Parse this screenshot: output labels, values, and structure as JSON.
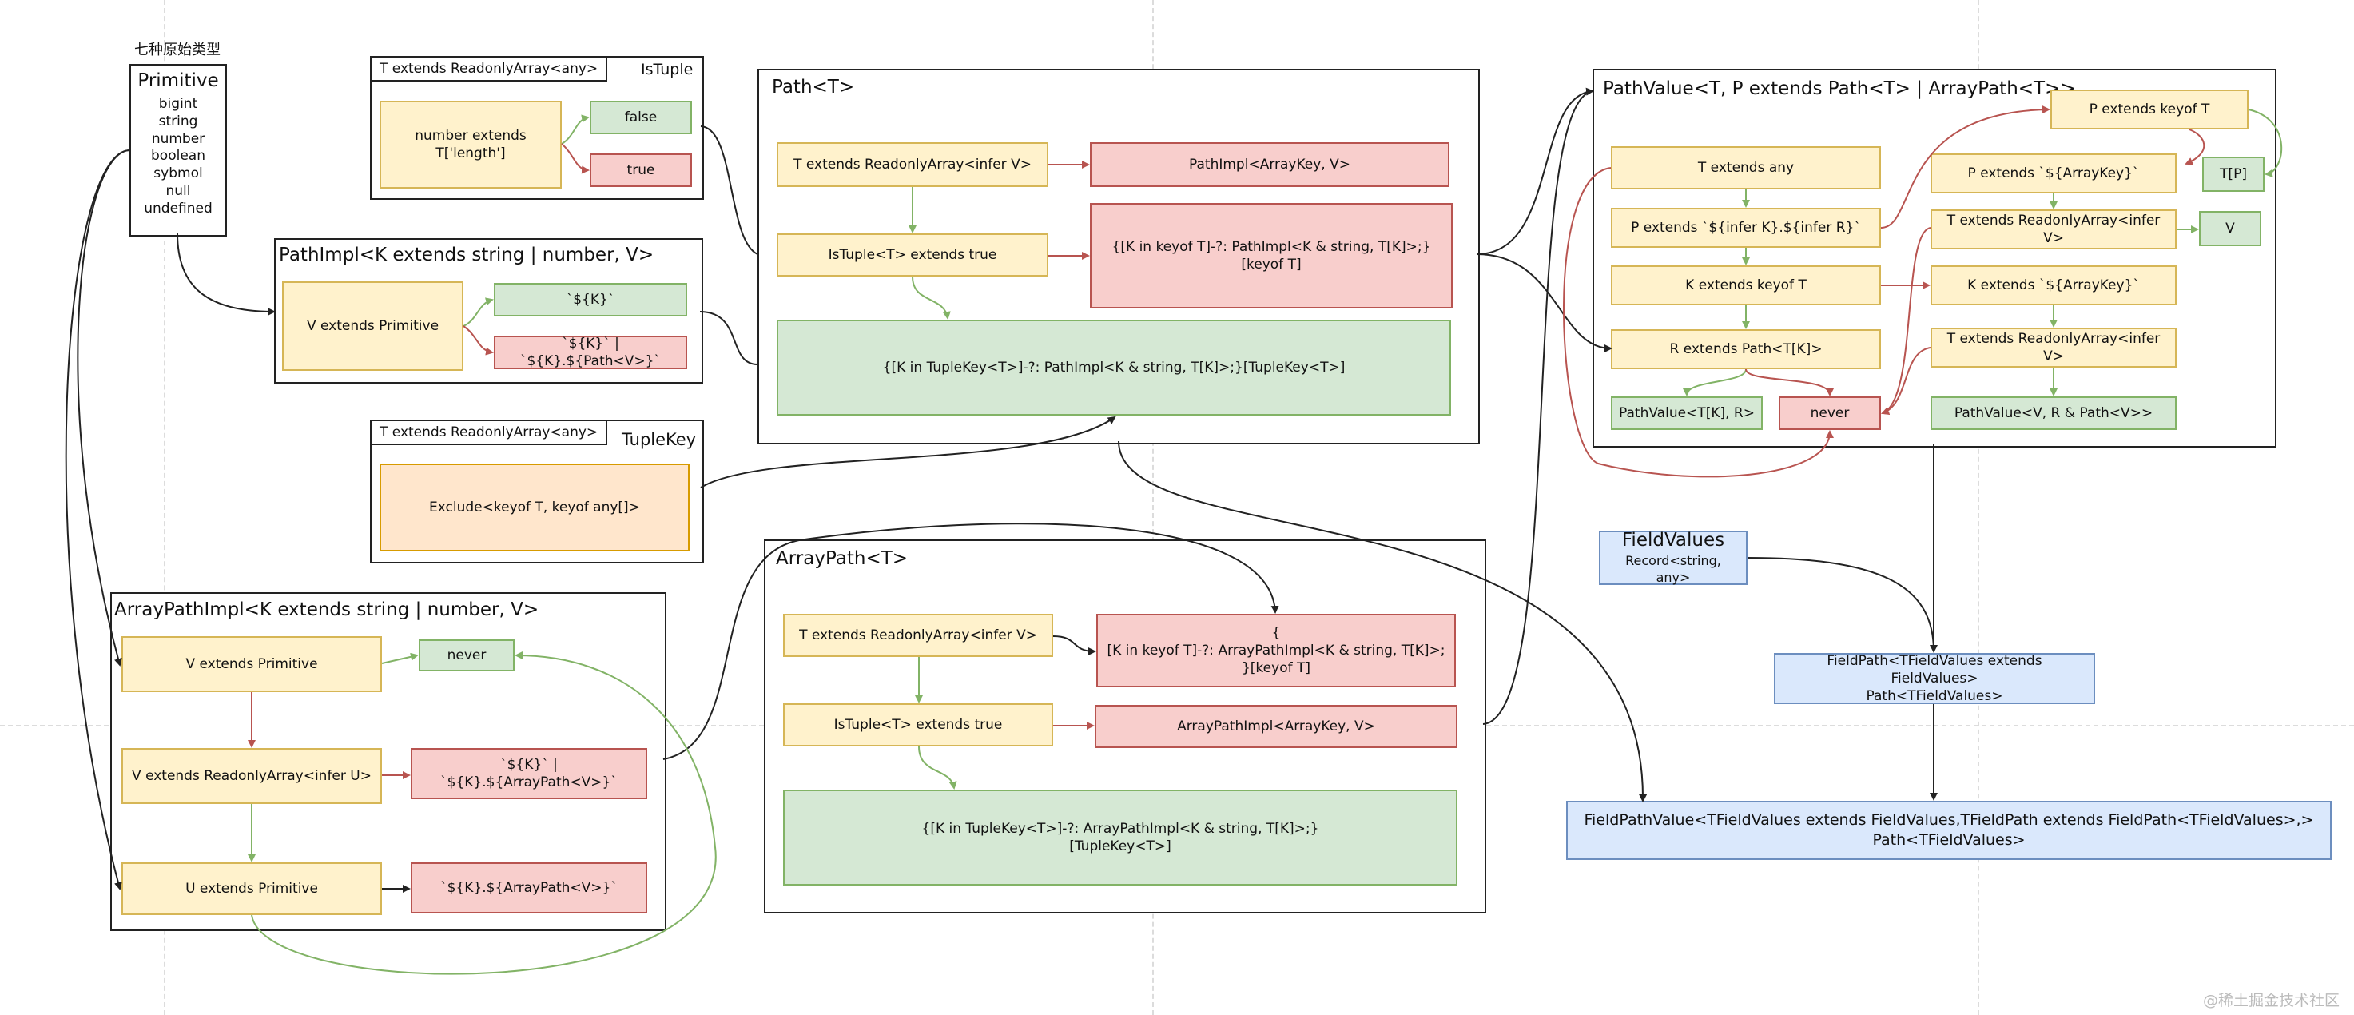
{
  "primitive": {
    "caption": "七种原始类型",
    "title": "Primitive",
    "items": [
      "bigint",
      "string",
      "number",
      "boolean",
      "sybmol",
      "null",
      "undefined"
    ]
  },
  "istuple": {
    "tag": "T extends ReadonlyArray<any>",
    "title": "IsTuple",
    "cond": "number extends\nT['length']",
    "false": "false",
    "true": "true"
  },
  "pathimpl": {
    "title": "PathImpl<K extends string | number, V>",
    "cond": "V extends Primitive",
    "a": "`${K}`",
    "b": "`${K}` | `${K}.${Path<V>}`"
  },
  "tuplekey": {
    "tag": "T extends ReadonlyArray<any>",
    "title": "TupleKey",
    "body": "Exclude<keyof T, keyof any[]>"
  },
  "arraypathimpl": {
    "title": "ArrayPathImpl<K extends string | number, V>",
    "c1": "V extends Primitive",
    "never": "never",
    "c2": "V extends ReadonlyArray<infer U>",
    "r2": "`${K}` | `${K}.${ArrayPath<V>}`",
    "c3": "U extends Primitive",
    "r3": "`${K}.${ArrayPath<V>}`"
  },
  "path": {
    "title": "Path<T>",
    "c1": "T extends ReadonlyArray<infer V>",
    "r1": "PathImpl<ArrayKey, V>",
    "c2": "IsTuple<T> extends true",
    "r2": "{[K in keyof T]-?: PathImpl<K & string, T[K]>;}\n[keyof T]",
    "g": "{[K in TupleKey<T>]-?: PathImpl<K & string, T[K]>;}[TupleKey<T>]"
  },
  "arraypath": {
    "title": "ArrayPath<T>",
    "c1": "T extends ReadonlyArray<infer V>",
    "r1": "{\n[K in keyof T]-?: ArrayPathImpl<K & string, T[K]>;\n}[keyof T]",
    "c2": "IsTuple<T> extends true",
    "r2": "ArrayPathImpl<ArrayKey, V>",
    "g": "{[K in TupleKey<T>]-?: ArrayPathImpl<K & string, T[K]>;}\n[TupleKey<T>]"
  },
  "pathvalue": {
    "title": "PathValue<T, P extends Path<T> | ArrayPath<T>>",
    "l1": "T extends any",
    "l2": "P extends `${infer K}.${infer R}`",
    "l3": "K extends keyof T",
    "l4": "R extends Path<T[K]>",
    "l5": "PathValue<T[K], R>",
    "never": "never",
    "top": "P extends keyof T",
    "tp": "T[P]",
    "m1": "P extends `${ArrayKey}`",
    "m2": "T extends ReadonlyArray<infer V>",
    "v": "V",
    "m3": "K extends `${ArrayKey}`",
    "m4": "T extends ReadonlyArray<infer V>",
    "m5": "PathValue<V, R & Path<V>>"
  },
  "fieldvalues": {
    "title": "FieldValues",
    "sub": "Record<string, any>"
  },
  "fieldpath": {
    "body": "FieldPath<TFieldValues extends FieldValues>\nPath<TFieldValues>"
  },
  "fieldpathvalue": {
    "body": "FieldPathValue<TFieldValues extends FieldValues,TFieldPath extends FieldPath<TFieldValues>,>\nPath<TFieldValues>"
  },
  "watermark": "@稀土掘金技术社区",
  "colors": {
    "yellow": "#fff2cc",
    "red": "#f8cecc",
    "green": "#d5e8d4",
    "orange": "#ffe6cc",
    "blue": "#dae8fc"
  }
}
